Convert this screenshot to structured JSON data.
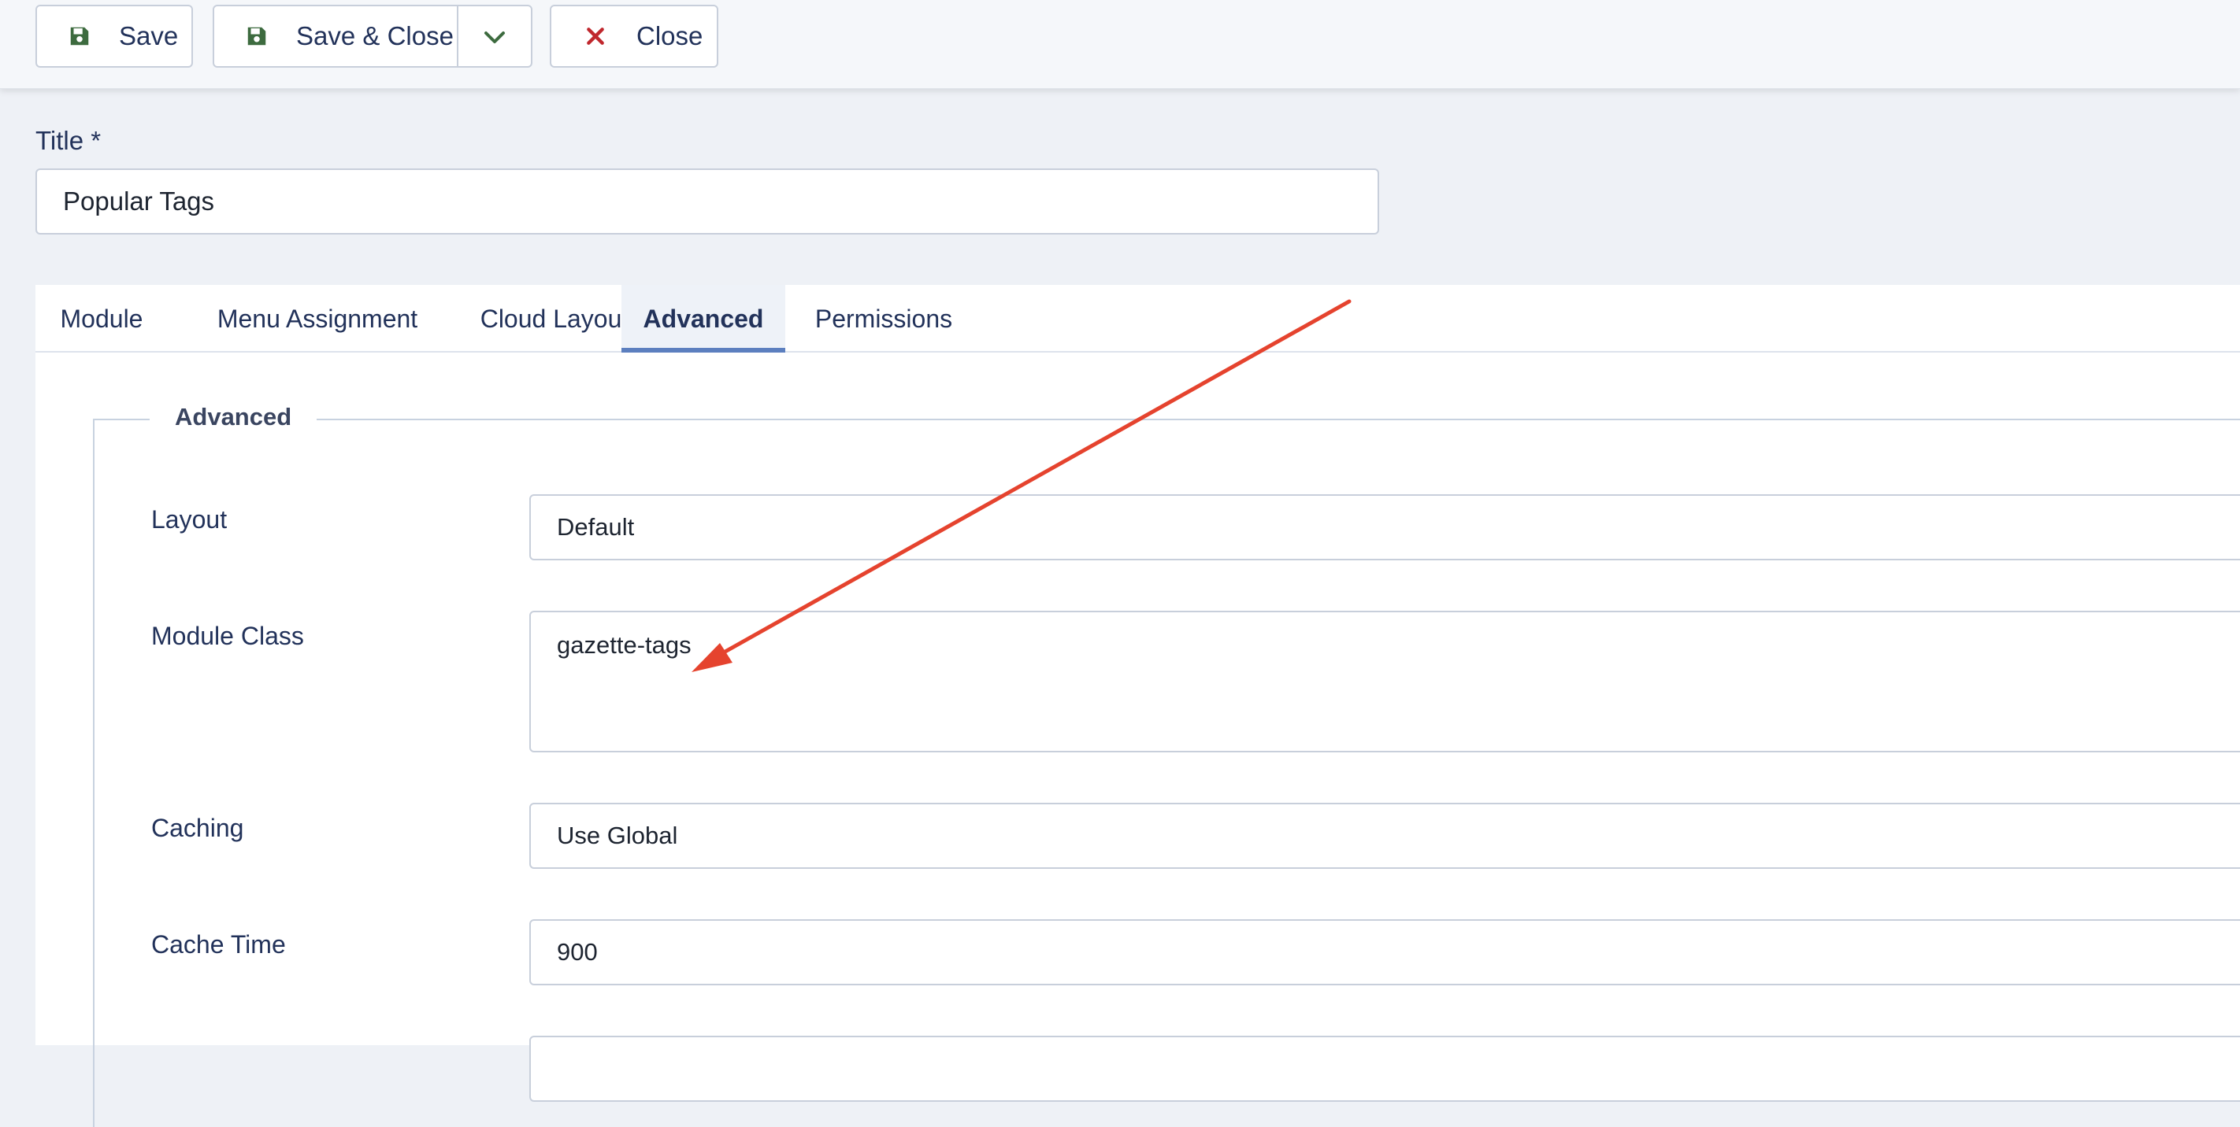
{
  "toolbar": {
    "save_label": "Save",
    "save_close_label": "Save & Close",
    "close_label": "Close",
    "save_icon": "save-icon",
    "close_icon": "close-icon",
    "dropdown_icon": "chevron-down-icon",
    "save_icon_color": "#3d6b3f",
    "close_icon_color": "#c0272d"
  },
  "title_field": {
    "label": "Title *",
    "value": "Popular Tags"
  },
  "tabs": [
    {
      "label": "Module",
      "active": false
    },
    {
      "label": "Menu Assignment",
      "active": false
    },
    {
      "label": "Cloud Layout",
      "active": false
    },
    {
      "label": "Advanced",
      "active": true
    },
    {
      "label": "Permissions",
      "active": false
    }
  ],
  "advanced": {
    "legend": "Advanced",
    "fields": [
      {
        "label": "Layout",
        "value": "Default"
      },
      {
        "label": "Module Class",
        "value": "gazette-tags"
      },
      {
        "label": "Caching",
        "value": "Use Global"
      },
      {
        "label": "Cache Time",
        "value": "900"
      }
    ]
  },
  "colors": {
    "accent": "#5c7fbf",
    "annotation_arrow": "#e5432e",
    "text": "#22325a"
  }
}
